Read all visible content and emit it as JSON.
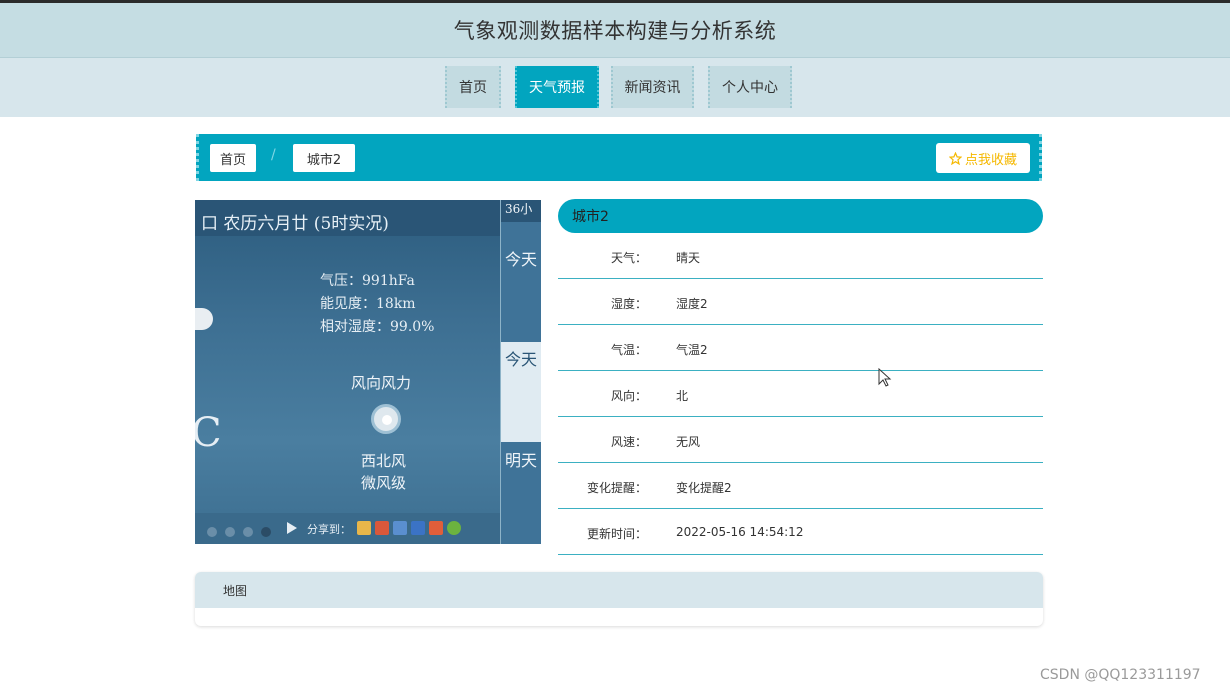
{
  "header": {
    "title": "气象观测数据样本构建与分析系统"
  },
  "nav": {
    "items": [
      {
        "label": "首页",
        "active": false
      },
      {
        "label": "天气预报",
        "active": true
      },
      {
        "label": "新闻资讯",
        "active": false
      },
      {
        "label": "个人中心",
        "active": false
      }
    ]
  },
  "breadcrumb": {
    "items": [
      "首页",
      "城市2"
    ],
    "separator": "/",
    "favorite_label": "点我收藏",
    "favorite_icon": "star-icon"
  },
  "weather_image": {
    "top_text": "口 农历六月廿    (5时实况)",
    "pressure": "气压：991hFa",
    "visibility": "能见度：18km",
    "humidity": "相对湿度：99.0%",
    "wind_title": "风向风力",
    "wind_dir": "西北风",
    "wind_level": "微风级",
    "share_label": "分享到：",
    "side_top": "36小",
    "side_today1": "今天",
    "side_today2": "今天",
    "side_tomorrow": "明天",
    "temp_glyph": "C"
  },
  "detail": {
    "city": "城市2",
    "rows": [
      {
        "label": "天气：",
        "value": "晴天"
      },
      {
        "label": "湿度：",
        "value": "湿度2"
      },
      {
        "label": "气温：",
        "value": "气温2"
      },
      {
        "label": "风向：",
        "value": "北"
      },
      {
        "label": "风速：",
        "value": "无风"
      },
      {
        "label": "变化提醒：",
        "value": "变化提醒2"
      },
      {
        "label": "更新时间：",
        "value": "2022-05-16 14:54:12"
      }
    ]
  },
  "map": {
    "title": "地图"
  },
  "watermark": "CSDN @QQ123311197",
  "colors": {
    "accent": "#02a5bf",
    "header_bg": "#c5dde3",
    "nav_bg": "#d7e6ec",
    "favorite": "#f5b800"
  }
}
